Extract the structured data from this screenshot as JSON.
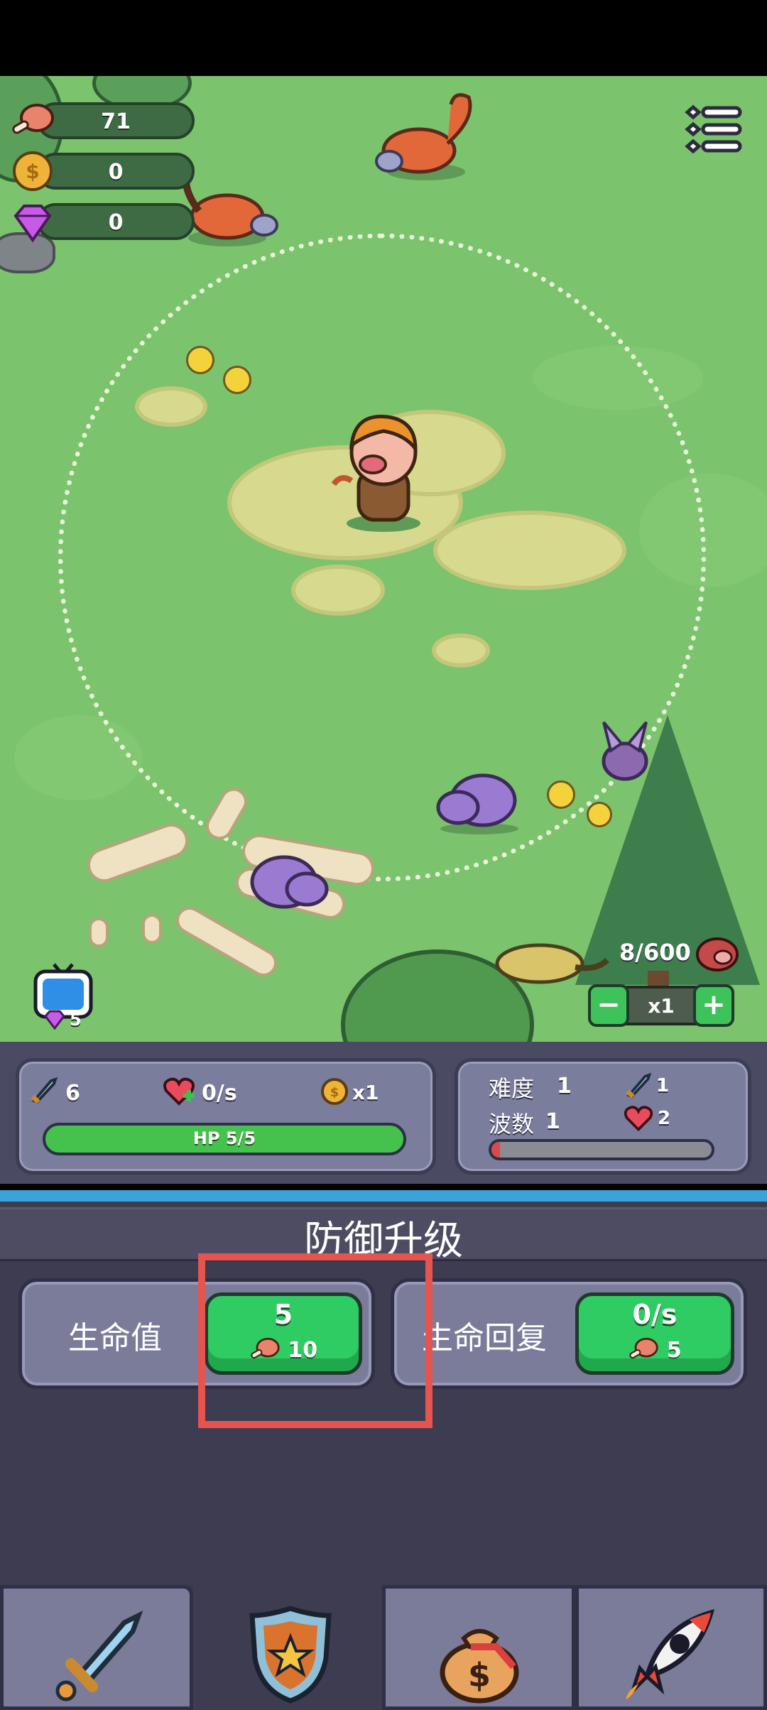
{
  "resources": {
    "meat": "71",
    "coins": "0",
    "gems": "0"
  },
  "field": {
    "kill_progress": "8/600",
    "speed": "x1",
    "speed_minus": "−",
    "speed_plus": "+",
    "ad_gems": "5"
  },
  "player_stats": {
    "attack": "6",
    "regen": "0/s",
    "coin_mult": "x1",
    "hp": "HP 5/5"
  },
  "wave_info": {
    "difficulty_label": "难度",
    "difficulty_value": "1",
    "wave_label": "波数",
    "wave_value": "1",
    "enemy_attack": "1",
    "enemy_hp": "2",
    "wave_progress": 0.02
  },
  "upgrade": {
    "title": "防御升级",
    "cards": [
      {
        "label": "生命值",
        "value": "5",
        "cost": "10"
      },
      {
        "label": "生命回复",
        "value": "0/s",
        "cost": "5"
      }
    ]
  },
  "tabs": [
    "sword-icon",
    "shield-star-icon",
    "money-bag-icon",
    "rocket-icon"
  ],
  "colors": {
    "grass": "#7cc36d",
    "panel": "#7b7d9c",
    "button_green": "#2ecc62",
    "highlight": "#e5544f",
    "divider": "#3aa3d9"
  }
}
